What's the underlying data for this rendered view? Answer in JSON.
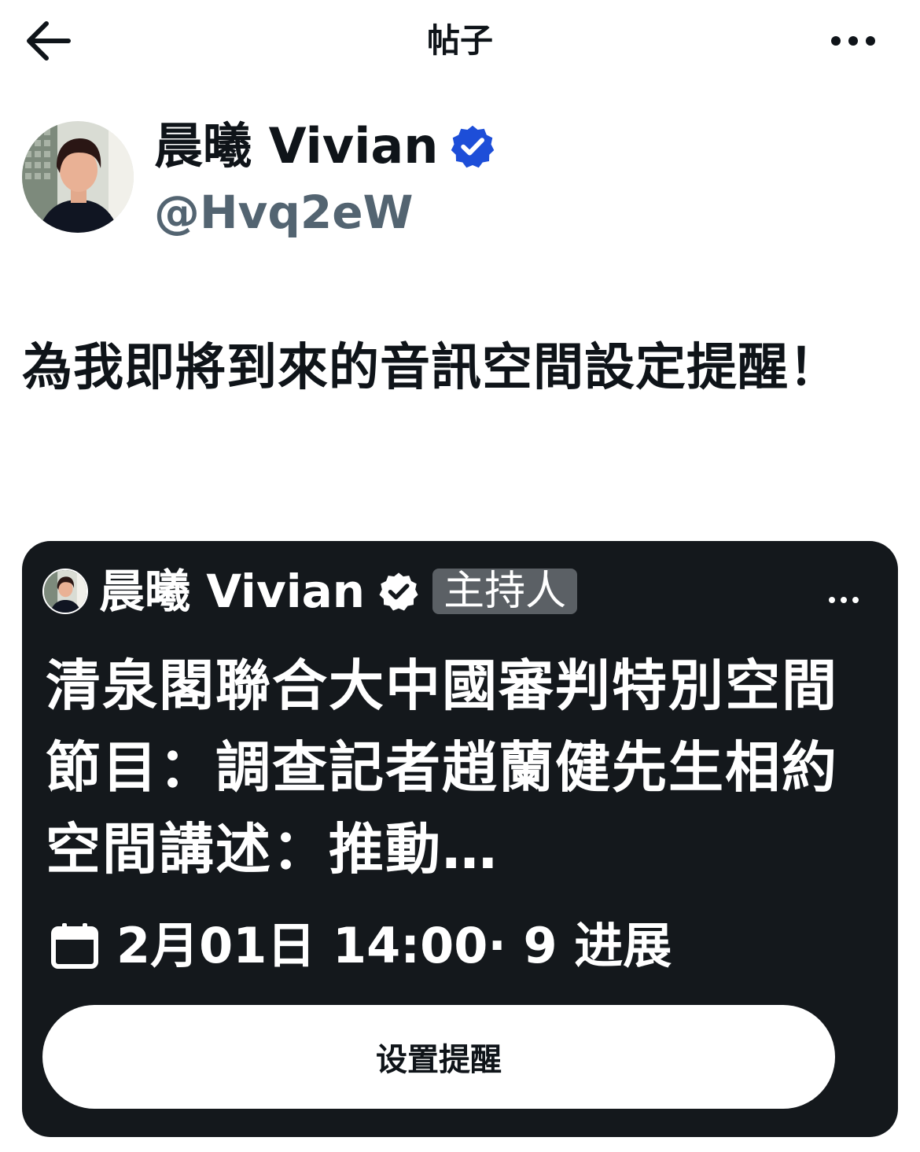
{
  "header": {
    "title": "帖子",
    "back_icon": "arrow-left-icon",
    "more_icon": "ellipsis-icon"
  },
  "author": {
    "name": "晨曦 Vivian",
    "handle": "@Hvq2eW",
    "verified": true,
    "verified_color": "#1d4ed8"
  },
  "post": {
    "text": "為我即將到來的音訊空間設定提醒！"
  },
  "space_card": {
    "host_name": "晨曦 Vivian",
    "host_role": "主持人",
    "title": "清泉閣聯合大中國審判特別空間節目：調查記者趙蘭健先生相約空間講述：推動…",
    "schedule": "2月01日 14:00· 9 进展",
    "calendar_icon": "calendar-icon",
    "reminder_button": "设置提醒",
    "background": "#14181c"
  }
}
